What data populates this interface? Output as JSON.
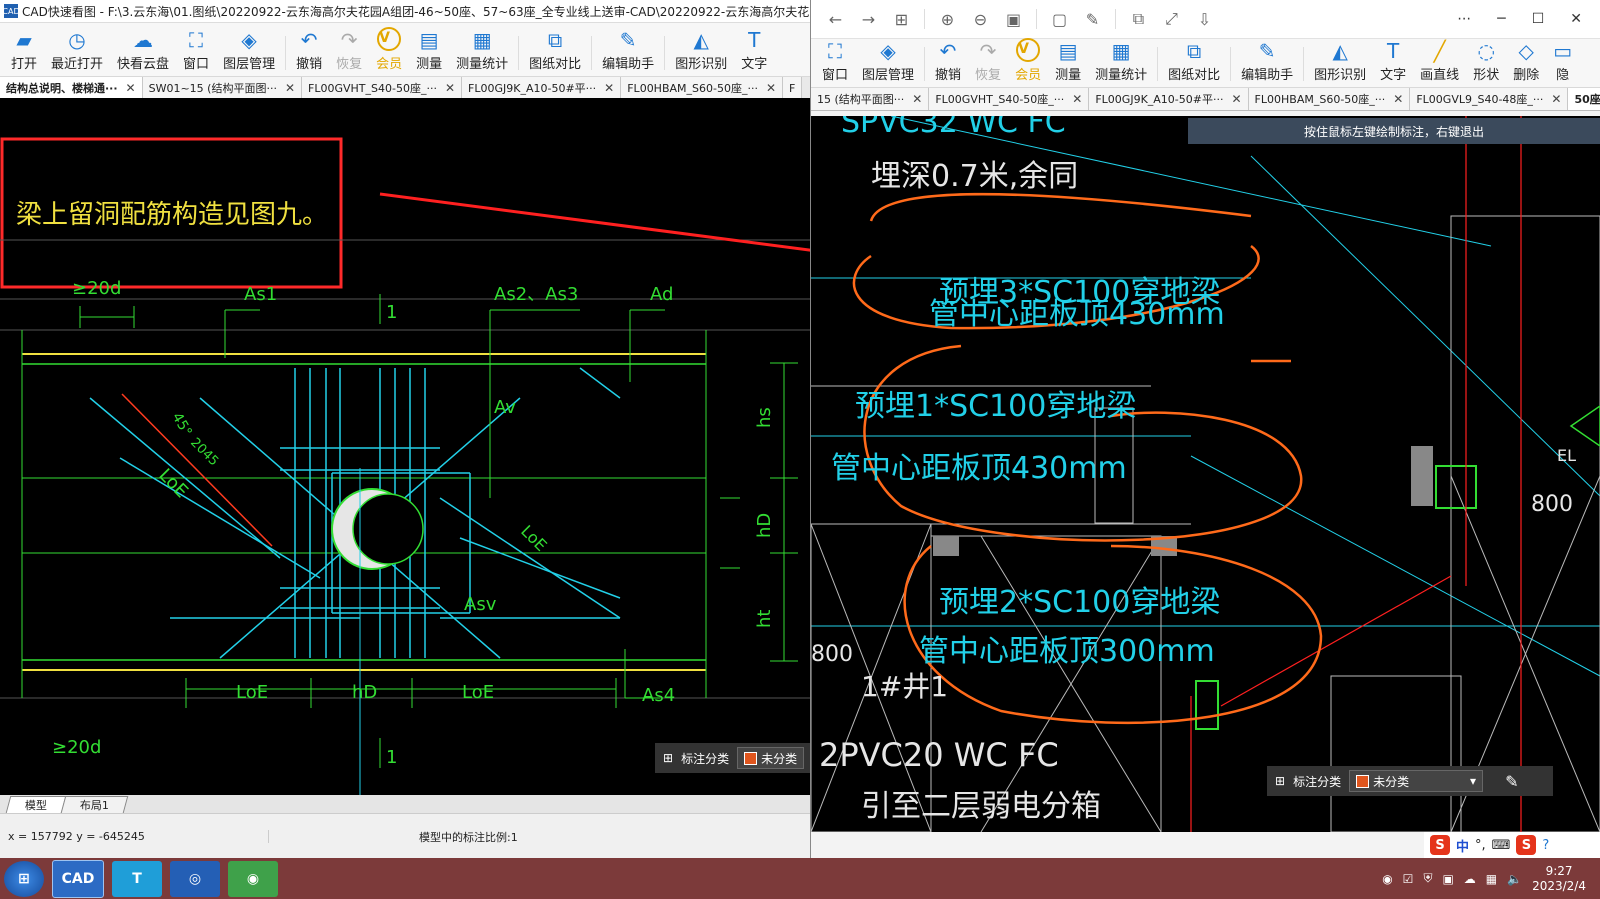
{
  "left": {
    "title": "CAD快速看图 - F:\\3.云东海\\01.图纸\\20220922-云东海高尔夫花园A组团-46~50座、57~63座_全专业线上送审-CAD\\20220922-云东海高尔夫花园",
    "toolbar": [
      "打开",
      "最近打开",
      "快看云盘",
      "窗口",
      "图层管理",
      "撤销",
      "恢复",
      "会员",
      "测量",
      "测量统计",
      "图纸对比",
      "编辑助手",
      "图形识别",
      "文字"
    ],
    "tabs": [
      "结构总说明、楼梯通···",
      "SW01~15 (结构平面图···",
      "FL00GVHT_S40-50座_···",
      "FL00GJ9K_A10-50#平···",
      "FL00HBAM_S60-50座_···",
      "F"
    ],
    "cad": {
      "note": "梁上留洞配筋构造见图九。",
      "labels": [
        "≥20d",
        "As1",
        "1",
        "As2、As3",
        "Ad",
        "Av",
        "45°",
        "2045",
        "LoE",
        "LoE",
        "hs",
        "hD",
        "ht",
        "Asv",
        "LoE",
        "hD",
        "LoE",
        "As4",
        "≥20d",
        "1"
      ]
    },
    "annot_label": "标注分类",
    "annot_value": "未分类",
    "bottom_tabs": [
      "模型",
      "布局1"
    ],
    "coords": "x = 157792  y = -645245",
    "scale_text": "模型中的标注比例:1"
  },
  "right": {
    "toolbar": [
      "窗口",
      "图层管理",
      "撤销",
      "恢复",
      "会员",
      "测量",
      "测量统计",
      "图纸对比",
      "编辑助手",
      "图形识别",
      "文字",
      "画直线",
      "形状",
      "删除",
      "隐"
    ],
    "tabs": [
      "15 (结构平面图···",
      "FL00GVHT_S40-50座_···",
      "FL00GJ9K_A10-50#平···",
      "FL00HBAM_S60-50座_···",
      "FL00GVL9_S40-48座_···",
      "50座_"
    ],
    "hint": "按住鼠标左键绘制标注，右键退出",
    "cad": {
      "top1": "SPVC32 WC FC",
      "top2": "埋深0.7米,余同",
      "n3a": "预埋3*SC100穿地梁",
      "n3b": "管中心距板顶430mm",
      "n1a": "预埋1*SC100穿地梁",
      "n1b": "管中心距板顶430mm",
      "n2a": "预埋2*SC100穿地梁",
      "n2b": "管中心距板顶300mm",
      "b1": "2PVC20 WC FC",
      "b2": "引至二层弱电分箱",
      "el": "EL",
      "dim800a": "800",
      "dim800b": "800",
      "lift": "1#井1"
    },
    "annot_label": "标注分类",
    "annot_value": "未分类"
  },
  "taskbar": {
    "time": "9:27",
    "date": "2023/2/4",
    "ime_lang": "中"
  }
}
